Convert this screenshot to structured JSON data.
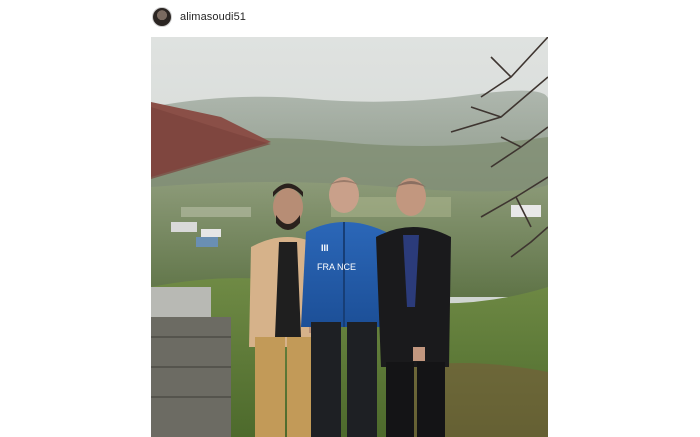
{
  "post": {
    "username": "alimasoudi51",
    "avatar_icon": "profile-avatar",
    "photo": {
      "jacket_text": "FRA NCE",
      "jacket_number": "III"
    }
  }
}
